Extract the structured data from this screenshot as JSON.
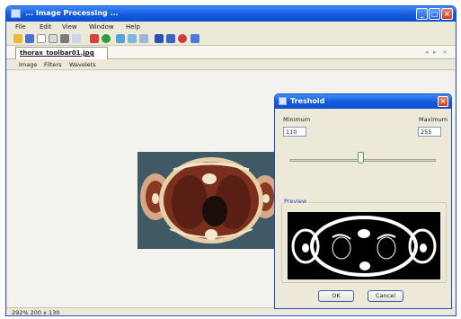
{
  "window": {
    "title": "... Image Processing ..."
  },
  "menu": [
    "File",
    "Edit",
    "View",
    "Window",
    "Help"
  ],
  "toolbar": {
    "icons": [
      "open-icon",
      "save-icon",
      "new-icon",
      "copy-icon",
      "print-icon",
      "export-icon",
      "cut-icon",
      "refresh-icon",
      "zoom-in-icon",
      "zoom-out-icon",
      "rotate-icon",
      "fit-icon",
      "window-icon",
      "settings-icon",
      "help-icon"
    ]
  },
  "tabs": {
    "active": "thorax_toolbar01.jpg"
  },
  "subtabs": [
    "Image",
    "Filters",
    "Wavelets"
  ],
  "status": {
    "text": "292%  200 x 130"
  },
  "dialog": {
    "title": "Treshold",
    "minimum_label": "Minimum",
    "maximum_label": "Maximum",
    "minimum_value": "110",
    "maximum_value": "255",
    "slider_level": 0.49,
    "preview_label": "Preview",
    "ok_label": "OK",
    "cancel_label": "Cancel"
  },
  "colors": {
    "titlebar": "#1459dd",
    "dialog_border": "#1d4cc7",
    "window_bg": "#ece9d8"
  }
}
